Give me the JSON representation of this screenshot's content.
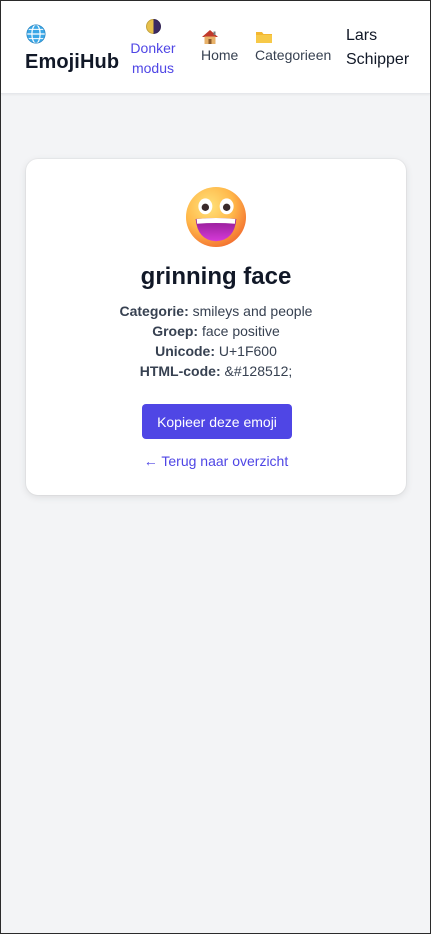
{
  "header": {
    "brand": "EmojiHub",
    "brand_icon": "globe-icon",
    "dark_mode": {
      "label": "Donker modus",
      "icon": "half-moon-icon"
    },
    "nav": [
      {
        "label": "Home",
        "icon": "house-icon"
      },
      {
        "label": "Categorieen",
        "icon": "folder-icon"
      }
    ],
    "user": "Lars Schipper"
  },
  "emoji": {
    "icon": "grinning-face-emoji",
    "name": "grinning face",
    "details": [
      {
        "label": "Categorie:",
        "value": "smileys and people"
      },
      {
        "label": "Groep:",
        "value": "face positive"
      },
      {
        "label": "Unicode:",
        "value": "U+1F600"
      },
      {
        "label": "HTML-code:",
        "value": "&#128512;"
      }
    ]
  },
  "actions": {
    "copy_label": "Kopieer deze emoji",
    "back_label": "← Terug naar overzicht"
  },
  "colors": {
    "accent": "#4f46e5",
    "background": "#f3f4f6",
    "card": "#ffffff"
  }
}
